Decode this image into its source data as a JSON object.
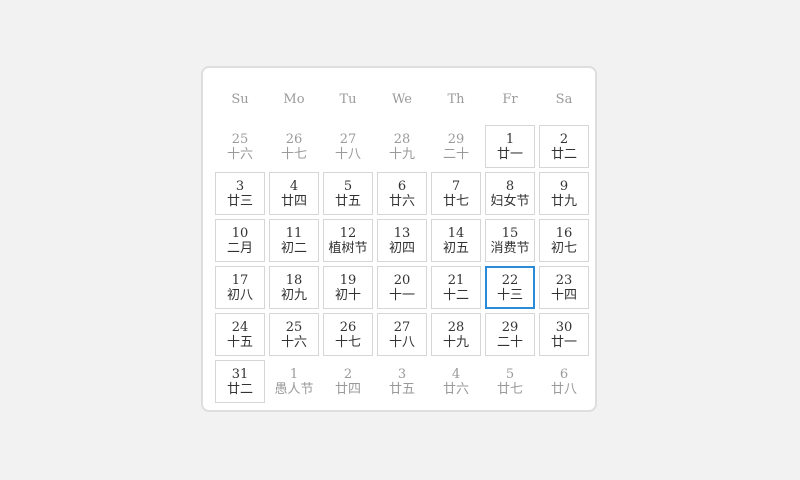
{
  "weekdays": [
    "Su",
    "Mo",
    "Tu",
    "We",
    "Th",
    "Fr",
    "Sa"
  ],
  "days": [
    {
      "day": "25",
      "lunar": "十六",
      "other": true
    },
    {
      "day": "26",
      "lunar": "十七",
      "other": true
    },
    {
      "day": "27",
      "lunar": "十八",
      "other": true
    },
    {
      "day": "28",
      "lunar": "十九",
      "other": true
    },
    {
      "day": "29",
      "lunar": "二十",
      "other": true
    },
    {
      "day": "1",
      "lunar": "廿一"
    },
    {
      "day": "2",
      "lunar": "廿二"
    },
    {
      "day": "3",
      "lunar": "廿三"
    },
    {
      "day": "4",
      "lunar": "廿四"
    },
    {
      "day": "5",
      "lunar": "廿五"
    },
    {
      "day": "6",
      "lunar": "廿六"
    },
    {
      "day": "7",
      "lunar": "廿七"
    },
    {
      "day": "8",
      "lunar": "妇女节"
    },
    {
      "day": "9",
      "lunar": "廿九"
    },
    {
      "day": "10",
      "lunar": "二月"
    },
    {
      "day": "11",
      "lunar": "初二"
    },
    {
      "day": "12",
      "lunar": "植树节"
    },
    {
      "day": "13",
      "lunar": "初四"
    },
    {
      "day": "14",
      "lunar": "初五"
    },
    {
      "day": "15",
      "lunar": "消费节"
    },
    {
      "day": "16",
      "lunar": "初七"
    },
    {
      "day": "17",
      "lunar": "初八"
    },
    {
      "day": "18",
      "lunar": "初九"
    },
    {
      "day": "19",
      "lunar": "初十"
    },
    {
      "day": "20",
      "lunar": "十一"
    },
    {
      "day": "21",
      "lunar": "十二"
    },
    {
      "day": "22",
      "lunar": "十三",
      "today": true
    },
    {
      "day": "23",
      "lunar": "十四"
    },
    {
      "day": "24",
      "lunar": "十五"
    },
    {
      "day": "25",
      "lunar": "十六"
    },
    {
      "day": "26",
      "lunar": "十七"
    },
    {
      "day": "27",
      "lunar": "十八"
    },
    {
      "day": "28",
      "lunar": "十九"
    },
    {
      "day": "29",
      "lunar": "二十"
    },
    {
      "day": "30",
      "lunar": "廿一"
    },
    {
      "day": "31",
      "lunar": "廿二"
    },
    {
      "day": "1",
      "lunar": "愚人节",
      "other": true
    },
    {
      "day": "2",
      "lunar": "廿四",
      "other": true
    },
    {
      "day": "3",
      "lunar": "廿五",
      "other": true
    },
    {
      "day": "4",
      "lunar": "廿六",
      "other": true
    },
    {
      "day": "5",
      "lunar": "廿七",
      "other": true
    },
    {
      "day": "6",
      "lunar": "廿八",
      "other": true
    }
  ],
  "colors": {
    "today_border": "#2b8bd9",
    "cell_border": "#d6d6d6",
    "muted_text": "#9a9a9a",
    "text": "#333333"
  }
}
